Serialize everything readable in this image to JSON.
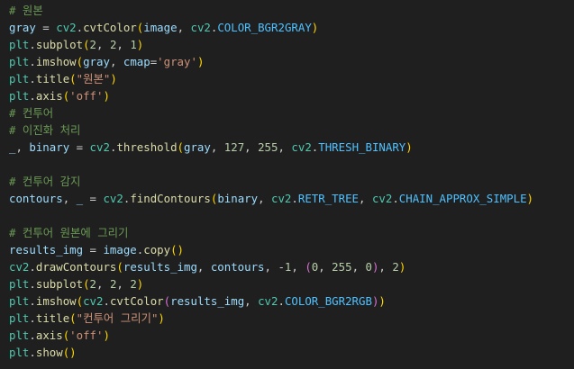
{
  "colors": {
    "background": "#1f1f1f",
    "comment": "#6a9955",
    "variable": "#9cdcfe",
    "module": "#4ec9b0",
    "function": "#dcdcaa",
    "string": "#ce9178",
    "number": "#b5cea8",
    "constant": "#4fc1ff",
    "bracket_gold": "#ffd700",
    "bracket_purple": "#da70d6",
    "bracket_blue": "#179fff",
    "default": "#cccccc"
  },
  "code_lines": [
    [
      {
        "t": "# 원본",
        "c": "comment"
      }
    ],
    [
      {
        "t": "gray",
        "c": "variable"
      },
      {
        "t": " = ",
        "c": "default"
      },
      {
        "t": "cv2",
        "c": "module"
      },
      {
        "t": ".",
        "c": "default"
      },
      {
        "t": "cvtColor",
        "c": "function"
      },
      {
        "t": "(",
        "c": "bracket_gold"
      },
      {
        "t": "image",
        "c": "variable"
      },
      {
        "t": ", ",
        "c": "default"
      },
      {
        "t": "cv2",
        "c": "module"
      },
      {
        "t": ".",
        "c": "default"
      },
      {
        "t": "COLOR_BGR2GRAY",
        "c": "constant"
      },
      {
        "t": ")",
        "c": "bracket_gold"
      }
    ],
    [
      {
        "t": "plt",
        "c": "module"
      },
      {
        "t": ".",
        "c": "default"
      },
      {
        "t": "subplot",
        "c": "function"
      },
      {
        "t": "(",
        "c": "bracket_gold"
      },
      {
        "t": "2",
        "c": "number"
      },
      {
        "t": ", ",
        "c": "default"
      },
      {
        "t": "2",
        "c": "number"
      },
      {
        "t": ", ",
        "c": "default"
      },
      {
        "t": "1",
        "c": "number"
      },
      {
        "t": ")",
        "c": "bracket_gold"
      }
    ],
    [
      {
        "t": "plt",
        "c": "module"
      },
      {
        "t": ".",
        "c": "default"
      },
      {
        "t": "imshow",
        "c": "function"
      },
      {
        "t": "(",
        "c": "bracket_gold"
      },
      {
        "t": "gray",
        "c": "variable"
      },
      {
        "t": ", ",
        "c": "default"
      },
      {
        "t": "cmap",
        "c": "variable"
      },
      {
        "t": "=",
        "c": "default"
      },
      {
        "t": "'gray'",
        "c": "string"
      },
      {
        "t": ")",
        "c": "bracket_gold"
      }
    ],
    [
      {
        "t": "plt",
        "c": "module"
      },
      {
        "t": ".",
        "c": "default"
      },
      {
        "t": "title",
        "c": "function"
      },
      {
        "t": "(",
        "c": "bracket_gold"
      },
      {
        "t": "\"원본\"",
        "c": "string"
      },
      {
        "t": ")",
        "c": "bracket_gold"
      }
    ],
    [
      {
        "t": "plt",
        "c": "module"
      },
      {
        "t": ".",
        "c": "default"
      },
      {
        "t": "axis",
        "c": "function"
      },
      {
        "t": "(",
        "c": "bracket_gold"
      },
      {
        "t": "'off'",
        "c": "string"
      },
      {
        "t": ")",
        "c": "bracket_gold"
      }
    ],
    [
      {
        "t": "# 컨투어",
        "c": "comment"
      }
    ],
    [
      {
        "t": "# 이진화 처리",
        "c": "comment"
      }
    ],
    [
      {
        "t": "_",
        "c": "variable"
      },
      {
        "t": ", ",
        "c": "default"
      },
      {
        "t": "binary",
        "c": "variable"
      },
      {
        "t": " = ",
        "c": "default"
      },
      {
        "t": "cv2",
        "c": "module"
      },
      {
        "t": ".",
        "c": "default"
      },
      {
        "t": "threshold",
        "c": "function"
      },
      {
        "t": "(",
        "c": "bracket_gold"
      },
      {
        "t": "gray",
        "c": "variable"
      },
      {
        "t": ", ",
        "c": "default"
      },
      {
        "t": "127",
        "c": "number"
      },
      {
        "t": ", ",
        "c": "default"
      },
      {
        "t": "255",
        "c": "number"
      },
      {
        "t": ", ",
        "c": "default"
      },
      {
        "t": "cv2",
        "c": "module"
      },
      {
        "t": ".",
        "c": "default"
      },
      {
        "t": "THRESH_BINARY",
        "c": "constant"
      },
      {
        "t": ")",
        "c": "bracket_gold"
      }
    ],
    [],
    [
      {
        "t": "# 컨투어 감지",
        "c": "comment"
      }
    ],
    [
      {
        "t": "contours",
        "c": "variable"
      },
      {
        "t": ", ",
        "c": "default"
      },
      {
        "t": "_",
        "c": "variable"
      },
      {
        "t": " = ",
        "c": "default"
      },
      {
        "t": "cv2",
        "c": "module"
      },
      {
        "t": ".",
        "c": "default"
      },
      {
        "t": "findContours",
        "c": "function"
      },
      {
        "t": "(",
        "c": "bracket_gold"
      },
      {
        "t": "binary",
        "c": "variable"
      },
      {
        "t": ", ",
        "c": "default"
      },
      {
        "t": "cv2",
        "c": "module"
      },
      {
        "t": ".",
        "c": "default"
      },
      {
        "t": "RETR_TREE",
        "c": "constant"
      },
      {
        "t": ", ",
        "c": "default"
      },
      {
        "t": "cv2",
        "c": "module"
      },
      {
        "t": ".",
        "c": "default"
      },
      {
        "t": "CHAIN_APPROX_SIMPLE",
        "c": "constant"
      },
      {
        "t": ")",
        "c": "bracket_gold"
      }
    ],
    [],
    [
      {
        "t": "# 컨투어 원본에 그리기",
        "c": "comment"
      }
    ],
    [
      {
        "t": "results_img",
        "c": "variable"
      },
      {
        "t": " = ",
        "c": "default"
      },
      {
        "t": "image",
        "c": "variable"
      },
      {
        "t": ".",
        "c": "default"
      },
      {
        "t": "copy",
        "c": "function"
      },
      {
        "t": "()",
        "c": "bracket_gold"
      }
    ],
    [
      {
        "t": "cv2",
        "c": "module"
      },
      {
        "t": ".",
        "c": "default"
      },
      {
        "t": "drawContours",
        "c": "function"
      },
      {
        "t": "(",
        "c": "bracket_gold"
      },
      {
        "t": "results_img",
        "c": "variable"
      },
      {
        "t": ", ",
        "c": "default"
      },
      {
        "t": "contours",
        "c": "variable"
      },
      {
        "t": ", ",
        "c": "default"
      },
      {
        "t": "-",
        "c": "default"
      },
      {
        "t": "1",
        "c": "number"
      },
      {
        "t": ", ",
        "c": "default"
      },
      {
        "t": "(",
        "c": "bracket_purple"
      },
      {
        "t": "0",
        "c": "number"
      },
      {
        "t": ", ",
        "c": "default"
      },
      {
        "t": "255",
        "c": "number"
      },
      {
        "t": ", ",
        "c": "default"
      },
      {
        "t": "0",
        "c": "number"
      },
      {
        "t": ")",
        "c": "bracket_purple"
      },
      {
        "t": ", ",
        "c": "default"
      },
      {
        "t": "2",
        "c": "number"
      },
      {
        "t": ")",
        "c": "bracket_gold"
      }
    ],
    [
      {
        "t": "plt",
        "c": "module"
      },
      {
        "t": ".",
        "c": "default"
      },
      {
        "t": "subplot",
        "c": "function"
      },
      {
        "t": "(",
        "c": "bracket_gold"
      },
      {
        "t": "2",
        "c": "number"
      },
      {
        "t": ", ",
        "c": "default"
      },
      {
        "t": "2",
        "c": "number"
      },
      {
        "t": ", ",
        "c": "default"
      },
      {
        "t": "2",
        "c": "number"
      },
      {
        "t": ")",
        "c": "bracket_gold"
      }
    ],
    [
      {
        "t": "plt",
        "c": "module"
      },
      {
        "t": ".",
        "c": "default"
      },
      {
        "t": "imshow",
        "c": "function"
      },
      {
        "t": "(",
        "c": "bracket_gold"
      },
      {
        "t": "cv2",
        "c": "module"
      },
      {
        "t": ".",
        "c": "default"
      },
      {
        "t": "cvtColor",
        "c": "function"
      },
      {
        "t": "(",
        "c": "bracket_purple"
      },
      {
        "t": "results_img",
        "c": "variable"
      },
      {
        "t": ", ",
        "c": "default"
      },
      {
        "t": "cv2",
        "c": "module"
      },
      {
        "t": ".",
        "c": "default"
      },
      {
        "t": "COLOR_BGR2RGB",
        "c": "constant"
      },
      {
        "t": ")",
        "c": "bracket_purple"
      },
      {
        "t": ")",
        "c": "bracket_gold"
      }
    ],
    [
      {
        "t": "plt",
        "c": "module"
      },
      {
        "t": ".",
        "c": "default"
      },
      {
        "t": "title",
        "c": "function"
      },
      {
        "t": "(",
        "c": "bracket_gold"
      },
      {
        "t": "\"컨투어 그리기\"",
        "c": "string"
      },
      {
        "t": ")",
        "c": "bracket_gold"
      }
    ],
    [
      {
        "t": "plt",
        "c": "module"
      },
      {
        "t": ".",
        "c": "default"
      },
      {
        "t": "axis",
        "c": "function"
      },
      {
        "t": "(",
        "c": "bracket_gold"
      },
      {
        "t": "'off'",
        "c": "string"
      },
      {
        "t": ")",
        "c": "bracket_gold"
      }
    ],
    [
      {
        "t": "plt",
        "c": "module"
      },
      {
        "t": ".",
        "c": "default"
      },
      {
        "t": "show",
        "c": "function"
      },
      {
        "t": "()",
        "c": "bracket_gold"
      }
    ]
  ]
}
